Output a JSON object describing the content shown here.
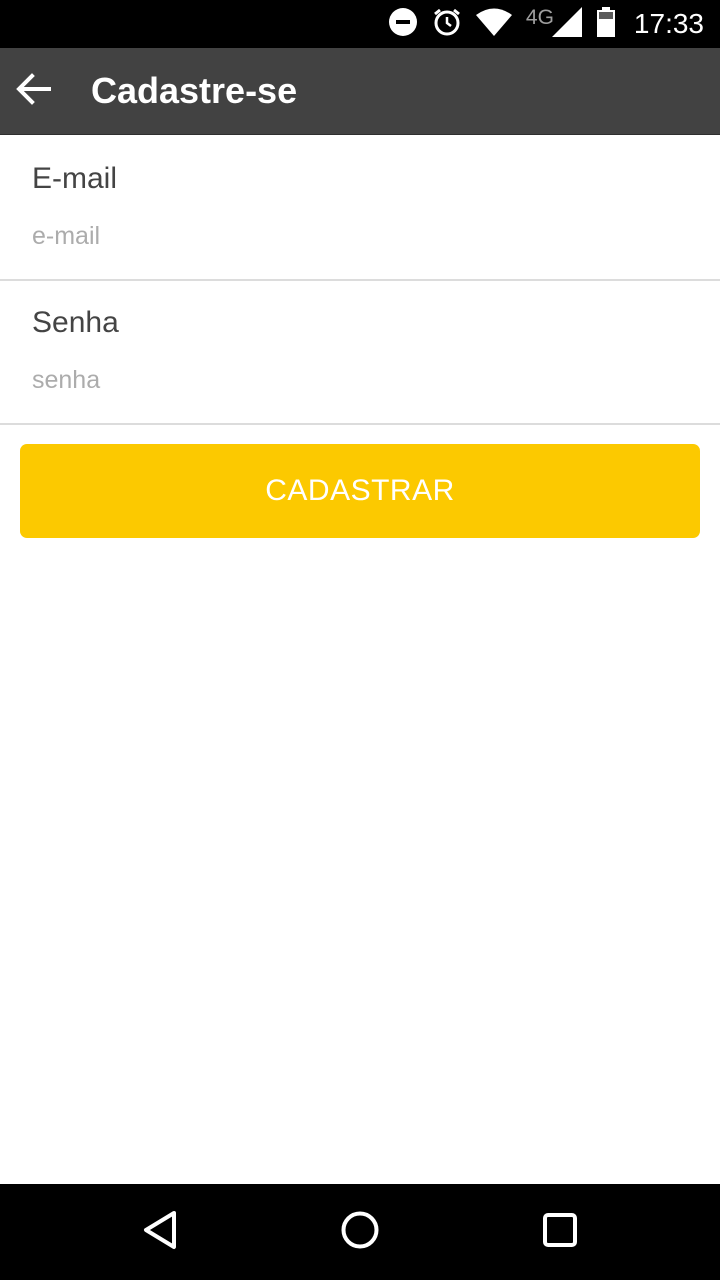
{
  "status_bar": {
    "time": "17:33",
    "network_label": "4G",
    "icons": [
      "do-not-disturb-icon",
      "alarm-icon",
      "wifi-icon",
      "signal-icon",
      "battery-icon"
    ]
  },
  "app_bar": {
    "title": "Cadastre-se",
    "back_icon": "arrow-back-icon"
  },
  "form": {
    "email": {
      "label": "E-mail",
      "placeholder": "e-mail",
      "value": ""
    },
    "senha": {
      "label": "Senha",
      "placeholder": "senha",
      "value": ""
    },
    "submit_label": "CADASTRAR"
  },
  "nav_bar": {
    "icons": [
      "nav-back-icon",
      "nav-home-icon",
      "nav-recents-icon"
    ]
  },
  "colors": {
    "status_bar": "#000000",
    "app_bar": "#424242",
    "accent": "#fcc900",
    "divider": "#dcdcdc",
    "placeholder": "#acacac"
  }
}
